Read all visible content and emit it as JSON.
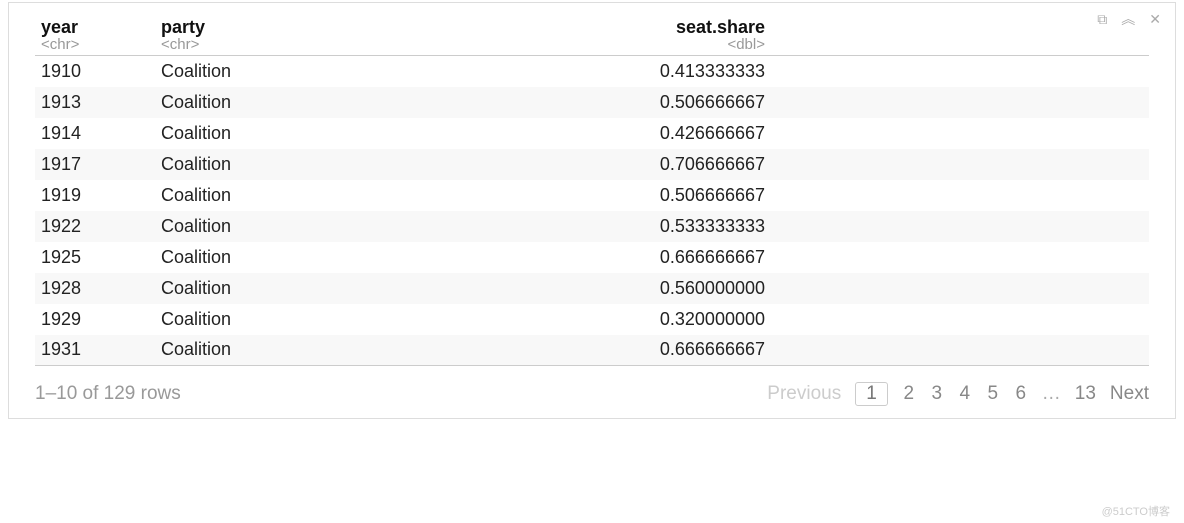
{
  "columns": [
    {
      "name": "year",
      "type": "<chr>"
    },
    {
      "name": "party",
      "type": "<chr>"
    },
    {
      "name": "seat.share",
      "type": "<dbl>"
    }
  ],
  "rows": [
    {
      "year": "1910",
      "party": "Coalition",
      "share": "0.413333333"
    },
    {
      "year": "1913",
      "party": "Coalition",
      "share": "0.506666667"
    },
    {
      "year": "1914",
      "party": "Coalition",
      "share": "0.426666667"
    },
    {
      "year": "1917",
      "party": "Coalition",
      "share": "0.706666667"
    },
    {
      "year": "1919",
      "party": "Coalition",
      "share": "0.506666667"
    },
    {
      "year": "1922",
      "party": "Coalition",
      "share": "0.533333333"
    },
    {
      "year": "1925",
      "party": "Coalition",
      "share": "0.666666667"
    },
    {
      "year": "1928",
      "party": "Coalition",
      "share": "0.560000000"
    },
    {
      "year": "1929",
      "party": "Coalition",
      "share": "0.320000000"
    },
    {
      "year": "1931",
      "party": "Coalition",
      "share": "0.666666667"
    }
  ],
  "footer": {
    "range": "1–10 of 129 rows",
    "previous": "Previous",
    "next": "Next",
    "pages": [
      "1",
      "2",
      "3",
      "4",
      "5",
      "6"
    ],
    "dots": "…",
    "last": "13"
  },
  "watermark": "@51CTO博客"
}
